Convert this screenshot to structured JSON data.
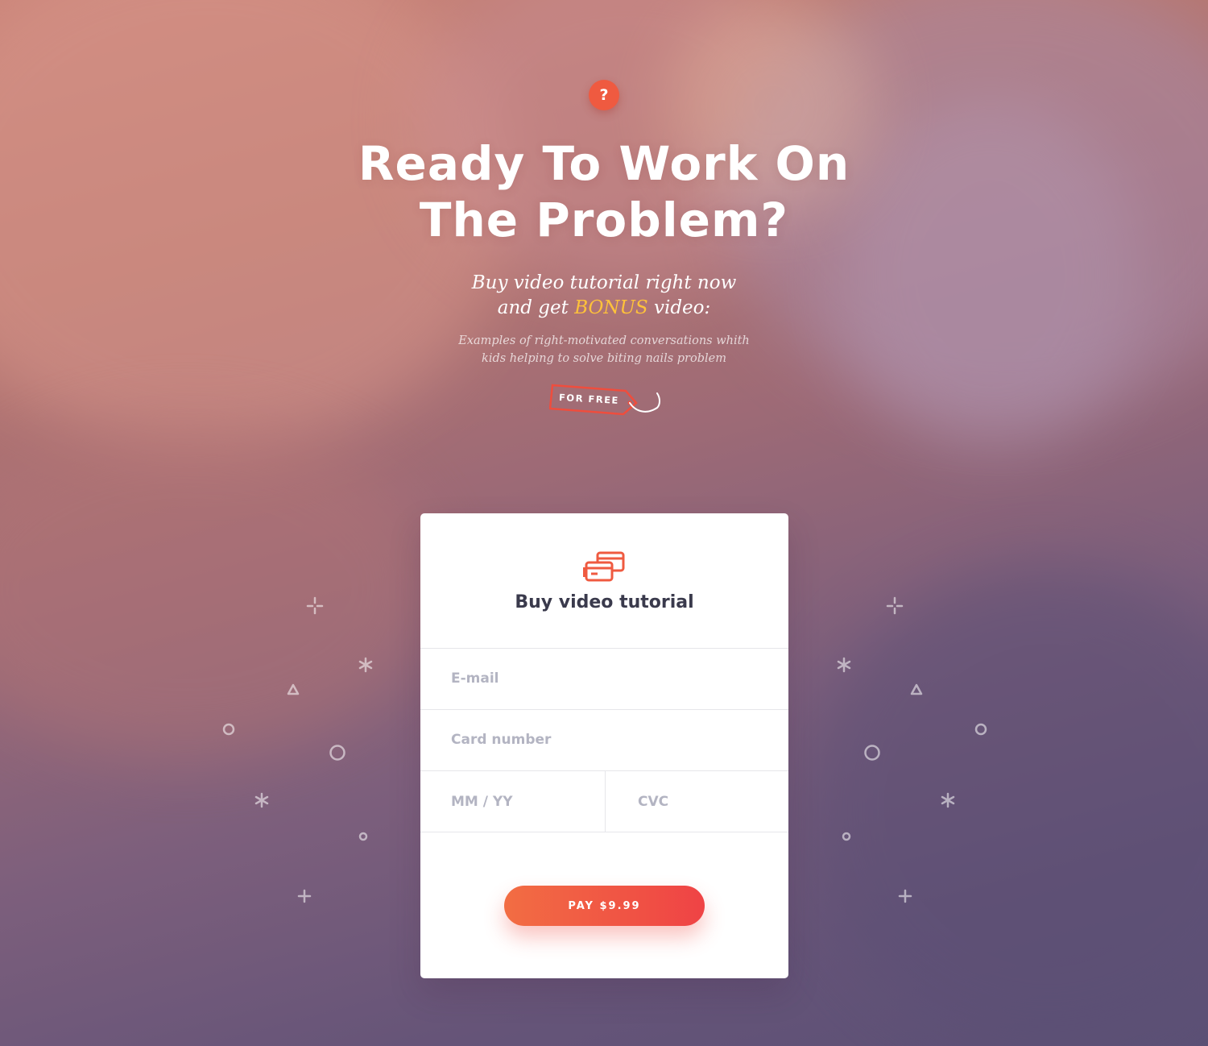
{
  "hero": {
    "badge": "?",
    "title_line1": "Ready To Work On",
    "title_line2": "The Problem?",
    "subtitle_line1": "Buy video tutorial right now",
    "subtitle_pre": "and get",
    "subtitle_bonus": "BONUS",
    "subtitle_post": "video:",
    "description_line1": "Examples of right-motivated conversations whith",
    "description_line2": "kids helping to solve biting nails problem",
    "tag_label": "FOR FREE"
  },
  "form": {
    "title": "Buy video tutorial",
    "email_placeholder": "E-mail",
    "card_placeholder": "Card number",
    "expiry_placeholder": "MM / YY",
    "cvc_placeholder": "CVC",
    "pay_label": "PAY $9.99"
  },
  "colors": {
    "accent": "#ef5a40",
    "bonus": "#ffc23a",
    "button_start": "#f26d43",
    "button_end": "#ef4345",
    "heading_text": "#3a3a4c",
    "placeholder_text": "#b3b4c2"
  },
  "icons": [
    "question-badge-icon",
    "price-tag-icon",
    "credit-cards-icon"
  ]
}
